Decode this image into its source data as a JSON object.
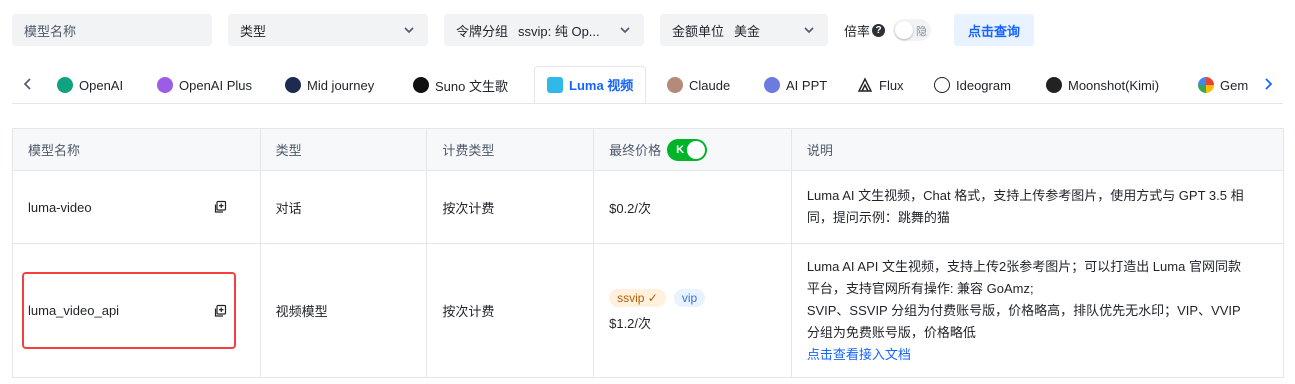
{
  "filters": {
    "model_name_placeholder": "模型名称",
    "type_label": "类型",
    "group_label": "令牌分组",
    "group_value": "ssvip: 纯 Op...",
    "currency_label": "金额单位",
    "currency_value": "美金",
    "rate_label": "倍率",
    "hide_toggle_text": "隐",
    "query_button": "点击查询"
  },
  "tabs": [
    {
      "label": "OpenAI",
      "icon": "openai-icon",
      "color": "#10a37f"
    },
    {
      "label": "OpenAI Plus",
      "icon": "openai-plus-icon",
      "color": "#9b5de5"
    },
    {
      "label": "Mid journey",
      "icon": "midjourney-icon",
      "color": "#1d2b50"
    },
    {
      "label": "Suno 文生歌",
      "icon": "suno-icon",
      "color": "#111111"
    },
    {
      "label": "Luma 视频",
      "icon": "luma-icon",
      "color": "#2fb8e8",
      "active": true
    },
    {
      "label": "Claude",
      "icon": "claude-icon",
      "color": "#b48a78"
    },
    {
      "label": "AI PPT",
      "icon": "ai-ppt-icon",
      "color": "#6c7be0"
    },
    {
      "label": "Flux",
      "icon": "flux-icon",
      "color": "#222222"
    },
    {
      "label": "Ideogram",
      "icon": "ideogram-icon",
      "color": "#222222"
    },
    {
      "label": "Moonshot(Kimi)",
      "icon": "moonshot-icon",
      "color": "#222222"
    },
    {
      "label": "Gem",
      "icon": "gemini-icon",
      "color": "#ea4335"
    }
  ],
  "table": {
    "headers": {
      "model": "模型名称",
      "type": "类型",
      "billing": "计费类型",
      "price": "最终价格",
      "price_toggle": "K",
      "description": "说明"
    },
    "rows": [
      {
        "model": "luma-video",
        "type": "对话",
        "billing": "按次计费",
        "price": "$0.2/次",
        "desc_lines": [
          "Luma AI 文生视频，Chat 格式，支持上传参考图片，使用方式与 GPT 3.5 相",
          "同，提问示例：跳舞的猫"
        ]
      },
      {
        "model": "luma_video_api",
        "type": "视频模型",
        "billing": "按次计费",
        "badges": [
          "ssvip ✓",
          "vip"
        ],
        "price": "$1.2/次",
        "desc_lines": [
          "Luma AI API 文生视频，支持上传2张参考图片；可以打造出 Luma 官网同款",
          "平台，支持官网所有操作: 兼容 GoAmz;",
          "SVIP、SSVIP 分组为付费账号版，价格略高，排队优先无水印；VIP、VVIP",
          "分组为免费账号版，价格略低"
        ],
        "desc_link": "点击查看接入文档"
      }
    ]
  },
  "colors": {
    "accent": "#1664ff",
    "toggle_on": "#00b42a",
    "highlight": "#f53f3f"
  }
}
